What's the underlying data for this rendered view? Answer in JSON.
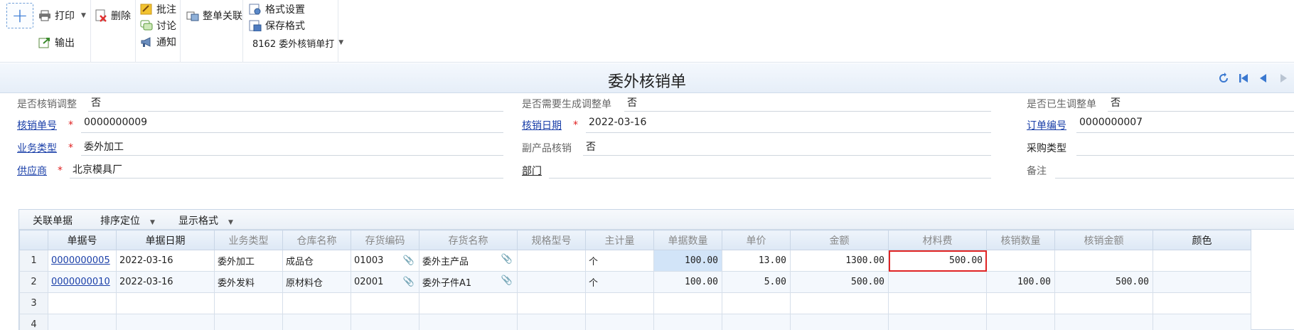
{
  "toolbar": {
    "add_label": "+",
    "print_label": "打印",
    "export_label": "输出",
    "delete_label": "删除",
    "annotate_label": "批注",
    "discuss_label": "讨论",
    "notify_label": "通知",
    "link_label": "整单关联",
    "format_settings_label": "格式设置",
    "save_format_label": "保存格式",
    "format_select_value": "8162 委外核销单打"
  },
  "title": "委外核销单",
  "form": {
    "adjust": {
      "label": "是否核销调整",
      "value": "否"
    },
    "need_adjust_doc": {
      "label": "是否需要生成调整单",
      "value": "否"
    },
    "adjust_generated": {
      "label": "是否已生调整单",
      "value": "否"
    },
    "writeoff_no": {
      "label": "核销单号",
      "value": "0000000009"
    },
    "writeoff_date": {
      "label": "核销日期",
      "value": "2022-03-16"
    },
    "order_no": {
      "label": "订单编号",
      "value": "0000000007"
    },
    "biz_type": {
      "label": "业务类型",
      "value": "委外加工"
    },
    "byproduct": {
      "label": "副产品核销",
      "value": "否"
    },
    "purchase_type": {
      "label": "采购类型",
      "value": ""
    },
    "supplier": {
      "label": "供应商",
      "value": "北京模具厂"
    },
    "dept": {
      "label": "部门",
      "value": ""
    },
    "remark": {
      "label": "备注",
      "value": ""
    },
    "required_mark": "*"
  },
  "grid": {
    "toolbar": {
      "related_docs": "关联单据",
      "sort_locate": "排序定位",
      "display_format": "显示格式"
    },
    "columns": [
      "单据号",
      "单据日期",
      "业务类型",
      "仓库名称",
      "存货编码",
      "存货名称",
      "规格型号",
      "主计量",
      "单据数量",
      "单价",
      "金额",
      "材料费",
      "核销数量",
      "核销金额",
      "颜色"
    ],
    "rows": [
      {
        "num": "1",
        "doc_no": "0000000005",
        "date": "2022-03-16",
        "biz_type": "委外加工",
        "warehouse": "成品仓",
        "inv_code": "01003",
        "inv_name": "委外主产品",
        "spec": "",
        "unit": "个",
        "qty": "100.00",
        "price": "13.00",
        "amount": "1300.00",
        "material_fee": "500.00",
        "wo_qty": "",
        "wo_amount": "",
        "color": ""
      },
      {
        "num": "2",
        "doc_no": "0000000010",
        "date": "2022-03-16",
        "biz_type": "委外发料",
        "warehouse": "原材料仓",
        "inv_code": "02001",
        "inv_name": "委外子件A1",
        "spec": "",
        "unit": "个",
        "qty": "100.00",
        "price": "5.00",
        "amount": "500.00",
        "material_fee": "",
        "wo_qty": "100.00",
        "wo_amount": "500.00",
        "color": ""
      },
      {
        "num": "3"
      },
      {
        "num": "4"
      }
    ]
  },
  "icons": {
    "attachment_glyph": "📎"
  },
  "colors": {
    "link": "#1a3fa8",
    "required": "#e02020",
    "highlight": "#e02424",
    "header_bg": "#dde8f5",
    "selected_cell": "#d2e4f8"
  }
}
